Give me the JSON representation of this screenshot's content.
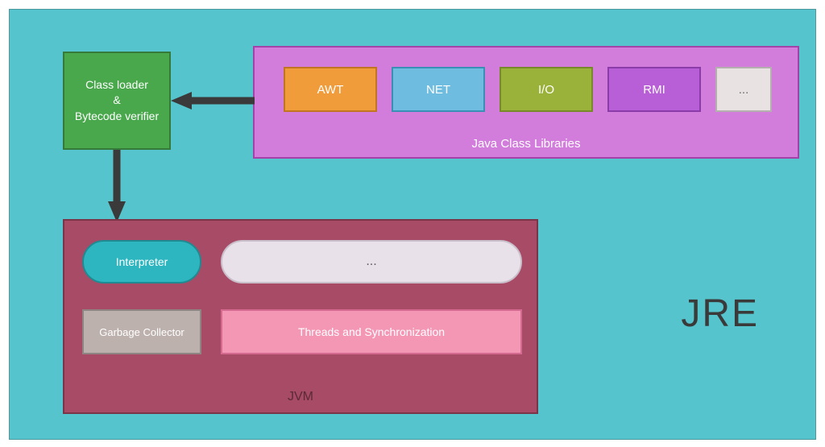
{
  "diagram": {
    "outer_label": "JRE",
    "classloader": {
      "line1": "Class loader",
      "line2": "&",
      "line3": "Bytecode verifier"
    },
    "jcl": {
      "title": "Java Class Libraries",
      "libs": {
        "awt": "AWT",
        "net": "NET",
        "io": "I/O",
        "rmi": "RMI",
        "more": "..."
      }
    },
    "jvm": {
      "title": "JVM",
      "interpreter": "Interpreter",
      "ellipsis": "...",
      "gc": "Garbage Collector",
      "threads": "Threads and Synchronization"
    }
  }
}
